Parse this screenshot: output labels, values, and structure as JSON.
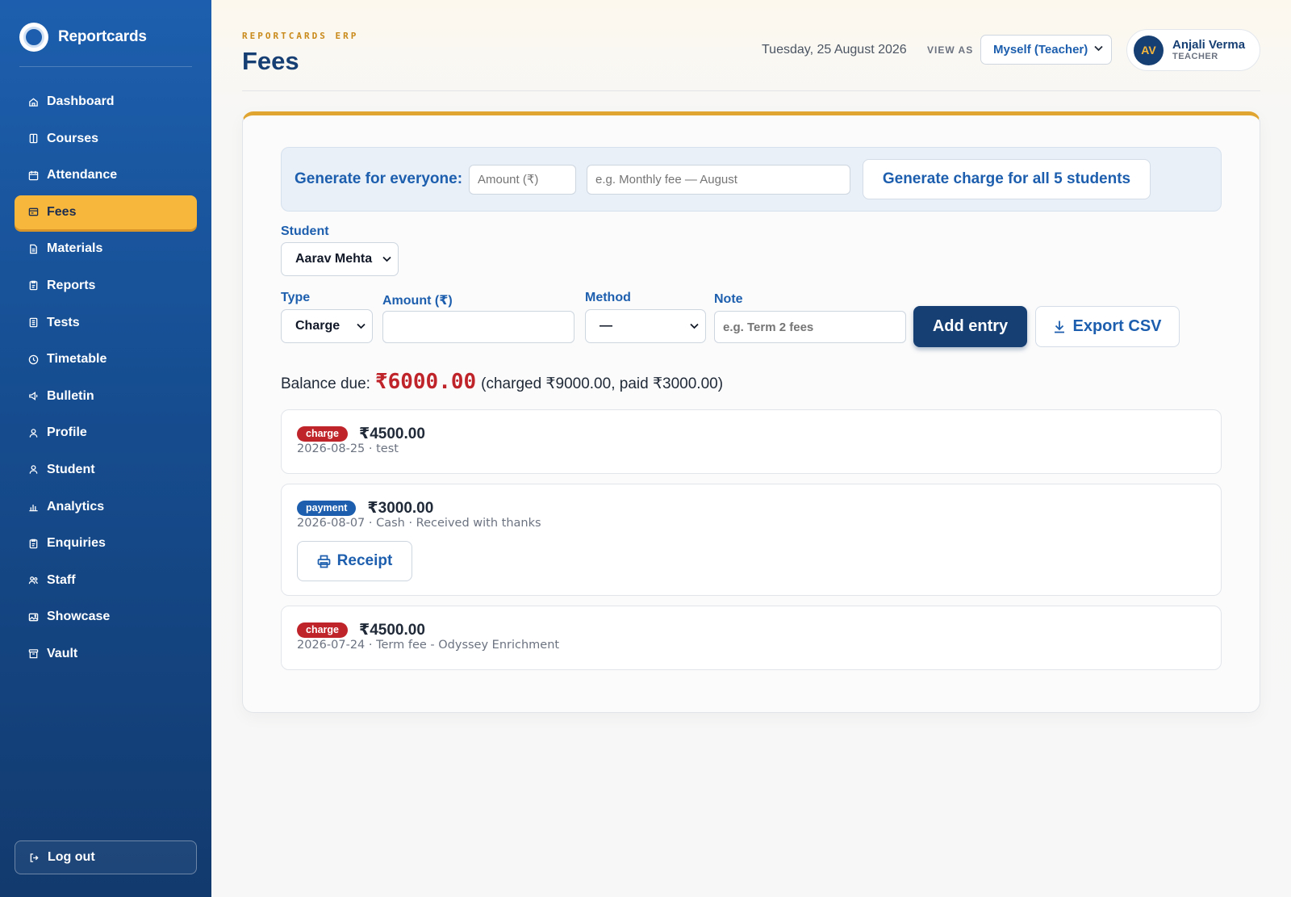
{
  "brand": {
    "name": "Reportcards"
  },
  "sidebar": {
    "items": [
      {
        "label": "Dashboard",
        "icon": "home-icon"
      },
      {
        "label": "Courses",
        "icon": "book-icon"
      },
      {
        "label": "Attendance",
        "icon": "calendar-icon"
      },
      {
        "label": "Fees",
        "icon": "wallet-icon",
        "active": true
      },
      {
        "label": "Materials",
        "icon": "file-icon"
      },
      {
        "label": "Reports",
        "icon": "clipboard-icon"
      },
      {
        "label": "Tests",
        "icon": "document-icon"
      },
      {
        "label": "Timetable",
        "icon": "clock-icon"
      },
      {
        "label": "Bulletin",
        "icon": "megaphone-icon"
      },
      {
        "label": "Profile",
        "icon": "user-icon"
      },
      {
        "label": "Student",
        "icon": "user-icon"
      },
      {
        "label": "Analytics",
        "icon": "bar-chart-icon"
      },
      {
        "label": "Enquiries",
        "icon": "clipboard-icon"
      },
      {
        "label": "Staff",
        "icon": "users-icon"
      },
      {
        "label": "Showcase",
        "icon": "image-icon"
      },
      {
        "label": "Vault",
        "icon": "archive-icon"
      }
    ],
    "logout": "Log out"
  },
  "header": {
    "eyebrow": "REPORTCARDS ERP",
    "title": "Fees",
    "date": "Tuesday, 25 August 2026",
    "view_as_label": "VIEW AS",
    "view_as_value": "Myself (Teacher)",
    "user": {
      "initials": "AV",
      "name": "Anjali Verma",
      "role": "TEACHER"
    }
  },
  "generate": {
    "label": "Generate for everyone:",
    "amount_placeholder": "Amount (₹)",
    "note_placeholder": "e.g. Monthly fee — August",
    "button": "Generate charge for all 5 students"
  },
  "form": {
    "student_label": "Student",
    "student_value": "Aarav Mehta",
    "type_label": "Type",
    "type_value": "Charge",
    "amount_label": "Amount (₹)",
    "amount_value": "",
    "method_label": "Method",
    "method_value": "—",
    "note_label": "Note",
    "note_placeholder": "e.g. Term 2 fees",
    "add_button": "Add entry",
    "export_button": "Export CSV"
  },
  "balance": {
    "label": "Balance due:",
    "amount": "₹6000.00",
    "detail": "(charged ₹9000.00, paid ₹3000.00)"
  },
  "entries": [
    {
      "type": "charge",
      "amount": "₹4500.00",
      "meta": "2026-08-25 · test"
    },
    {
      "type": "payment",
      "amount": "₹3000.00",
      "meta": "2026-08-07 · Cash · Received with thanks",
      "receipt": "Receipt"
    },
    {
      "type": "charge",
      "amount": "₹4500.00",
      "meta": "2026-07-24 · Term fee - Odyssey Enrichment"
    }
  ],
  "colors": {
    "sidebar_top": "#1d5fae",
    "sidebar_bottom": "#123a6e",
    "accent_gold": "#f6b73c",
    "primary_navy": "#163f74",
    "link_blue": "#1d5fae",
    "danger_red": "#c0242b"
  }
}
